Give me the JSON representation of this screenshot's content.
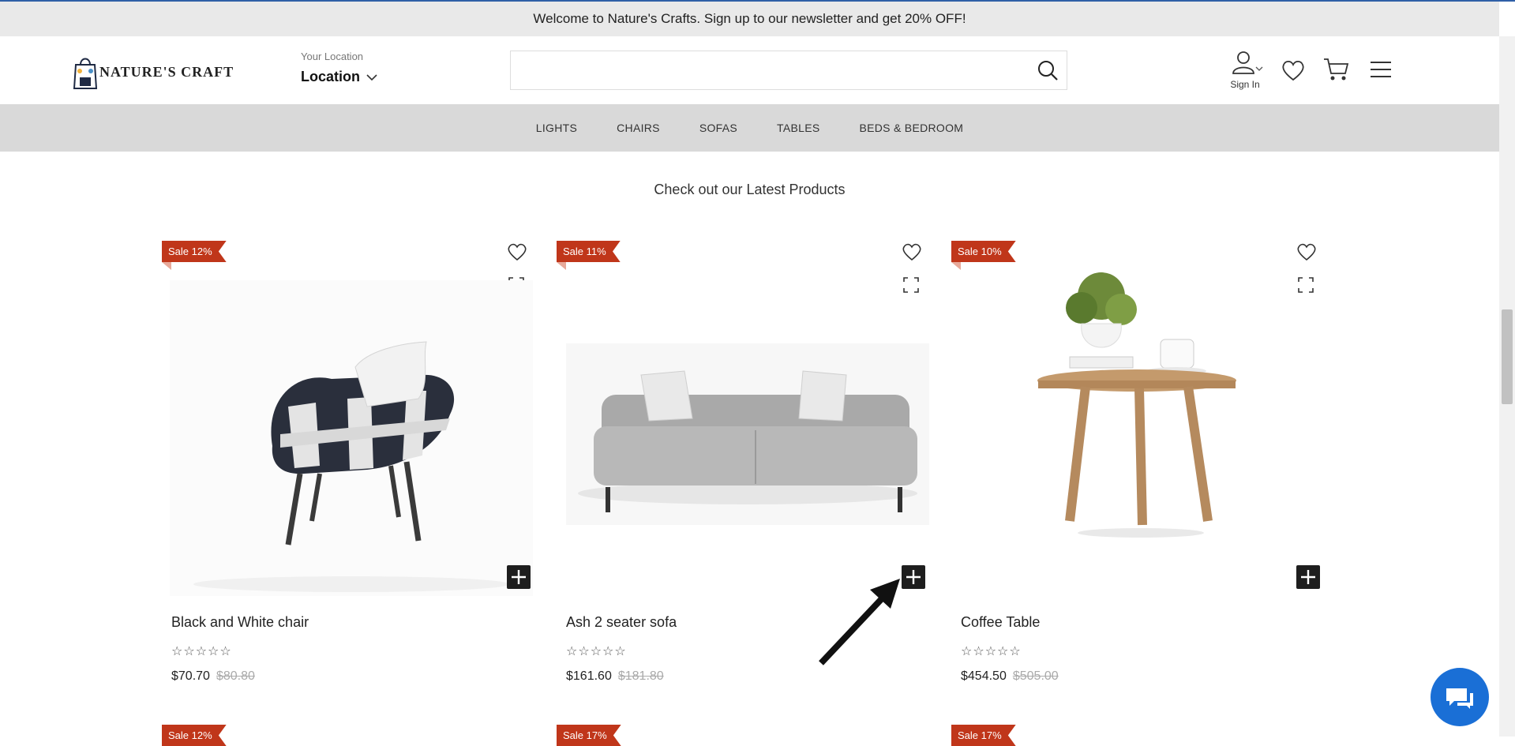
{
  "announcement": "Welcome to Nature's Crafts. Sign up to our newsletter and get 20% OFF!",
  "brand": {
    "name": "NATURE'S CRAFT"
  },
  "location": {
    "caption": "Your Location",
    "value": "Location"
  },
  "search": {
    "placeholder": ""
  },
  "account": {
    "label": "Sign In"
  },
  "nav": [
    "LIGHTS",
    "CHAIRS",
    "SOFAS",
    "TABLES",
    "BEDS & BEDROOM"
  ],
  "section_title": "Check out our Latest Products",
  "products": [
    {
      "badge": "Sale 12%",
      "name": "Black and White chair",
      "stars": "☆☆☆☆☆",
      "price": "$70.70",
      "old_price": "$80.80"
    },
    {
      "badge": "Sale 11%",
      "name": "Ash 2 seater sofa",
      "stars": "☆☆☆☆☆",
      "price": "$161.60",
      "old_price": "$181.80"
    },
    {
      "badge": "Sale 10%",
      "name": "Coffee Table",
      "stars": "☆☆☆☆☆",
      "price": "$454.50",
      "old_price": "$505.00"
    }
  ],
  "next_row_badges": [
    "Sale 12%",
    "Sale 17%",
    "Sale 17%"
  ],
  "colors": {
    "badge": "#c0361a",
    "nav_bg": "#d9d9d9",
    "chat": "#1a6fd6",
    "announce_bg": "#e9e9e9"
  }
}
